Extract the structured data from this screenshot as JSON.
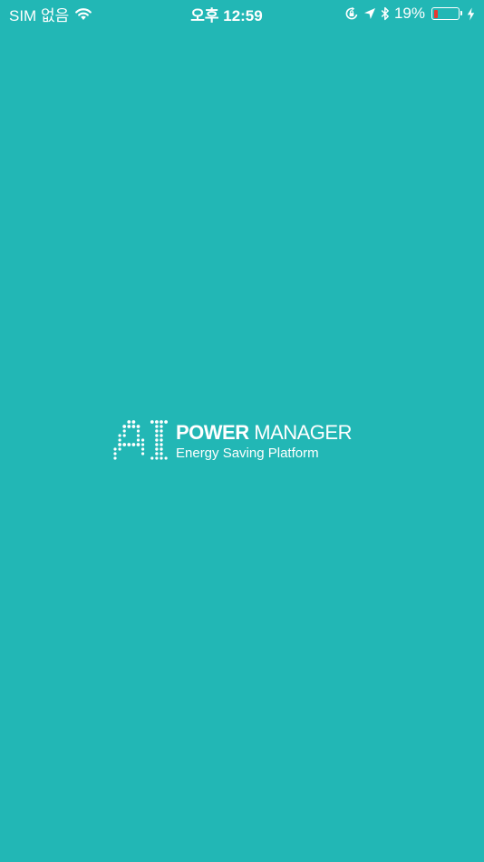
{
  "status_bar": {
    "carrier": "SIM 없음",
    "time": "오후 12:59",
    "battery_percent": "19%",
    "battery_level": 0.19,
    "battery_fill_color": "#e8382f",
    "icons": [
      "wifi-icon",
      "orientation-lock-icon",
      "location-arrow-icon",
      "bluetooth-icon",
      "battery-icon",
      "charging-bolt-icon"
    ]
  },
  "splash": {
    "background_color": "#22b7b5",
    "logo_mark": "AI",
    "brand_bold": "POWER",
    "brand_light": "MANAGER",
    "tagline": "Energy Saving Platform"
  }
}
